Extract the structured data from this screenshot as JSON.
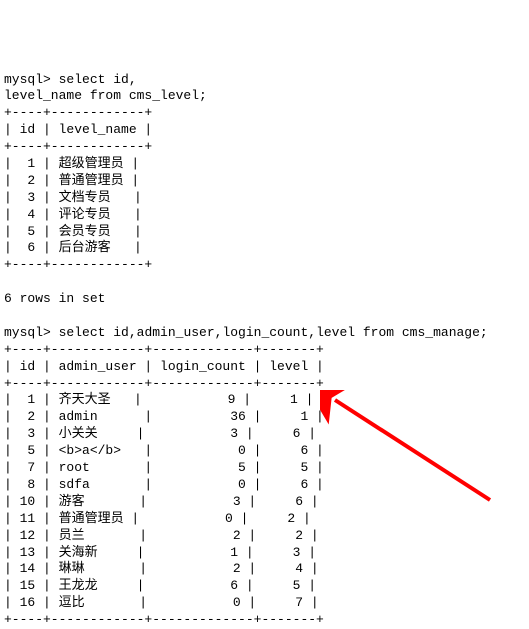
{
  "prompt": "mysql>",
  "query1": {
    "line1": "select id,",
    "line2": "level_name from cms_level;"
  },
  "table1": {
    "sep": "+----+------------+",
    "header_row": "| id | level_name |",
    "rows": [
      "|  1 | 超级管理员 |",
      "|  2 | 普通管理员 |",
      "|  3 | 文档专员   |",
      "|  4 | 评论专员   |",
      "|  5 | 会员专员   |",
      "|  6 | 后台游客   |"
    ],
    "footer": "6 rows in set"
  },
  "query2": "select id,admin_user,login_count,level from cms_manage;",
  "table2": {
    "sep": "+----+------------+-------------+-------+",
    "header_row": "| id | admin_user | login_count | level |",
    "rows": [
      "|  1 | 齐天大圣   |           9 |     1 |",
      "|  2 | admin      |          36 |     1 |",
      "|  3 | 小关关     |           3 |     6 |",
      "|  5 | <b>a</b>   |           0 |     6 |",
      "|  7 | root       |           5 |     5 |",
      "|  8 | sdfa       |           0 |     6 |",
      "| 10 | 游客       |           3 |     6 |",
      "| 11 | 普通管理员 |           0 |     2 |",
      "| 12 | 员兰       |           2 |     2 |",
      "| 13 | 关海新     |           1 |     3 |",
      "| 14 | 琳琳       |           2 |     4 |",
      "| 15 | 王龙龙     |           6 |     5 |",
      "| 16 | 逗比       |           0 |     7 |"
    ]
  },
  "chart_data": [
    {
      "type": "table",
      "title": "cms_level",
      "columns": [
        "id",
        "level_name"
      ],
      "rows": [
        [
          1,
          "超级管理员"
        ],
        [
          2,
          "普通管理员"
        ],
        [
          3,
          "文档专员"
        ],
        [
          4,
          "评论专员"
        ],
        [
          5,
          "会员专员"
        ],
        [
          6,
          "后台游客"
        ]
      ]
    },
    {
      "type": "table",
      "title": "cms_manage",
      "columns": [
        "id",
        "admin_user",
        "login_count",
        "level"
      ],
      "rows": [
        [
          1,
          "齐天大圣",
          9,
          1
        ],
        [
          2,
          "admin",
          36,
          1
        ],
        [
          3,
          "小关关",
          3,
          6
        ],
        [
          5,
          "<b>a</b>",
          0,
          6
        ],
        [
          7,
          "root",
          5,
          5
        ],
        [
          8,
          "sdfa",
          0,
          6
        ],
        [
          10,
          "游客",
          3,
          6
        ],
        [
          11,
          "普通管理员",
          0,
          2
        ],
        [
          12,
          "员兰",
          2,
          2
        ],
        [
          13,
          "关海新",
          1,
          3
        ],
        [
          14,
          "琳琳",
          2,
          4
        ],
        [
          15,
          "王龙龙",
          6,
          5
        ],
        [
          16,
          "逗比",
          0,
          7
        ]
      ]
    }
  ]
}
